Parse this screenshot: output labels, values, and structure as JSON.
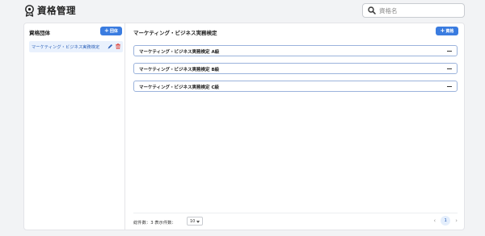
{
  "header": {
    "title": "資格管理",
    "icon": "award-badge-icon",
    "search": {
      "placeholder": "資格名",
      "value": "",
      "icon": "search-icon"
    }
  },
  "left": {
    "title": "資格団体",
    "add_button": {
      "icon": "plus-icon",
      "label": "団体"
    },
    "organizations": [
      {
        "label": "マーケティング・ビジネス実務検定",
        "selected": true,
        "edit_icon": "pencil-icon",
        "delete_icon": "trash-icon"
      }
    ]
  },
  "right": {
    "title": "マーケティング・ビジネス実務検定",
    "add_button": {
      "icon": "plus-icon",
      "label": "資格"
    },
    "certifications": [
      {
        "label": "マーケティング・ビジネス実務検定 A級",
        "action_icon": "minus-icon"
      },
      {
        "label": "マーケティング・ビジネス実務検定 B級",
        "action_icon": "minus-icon"
      },
      {
        "label": "マーケティング・ビジネス実務検定 C級",
        "action_icon": "minus-icon"
      }
    ],
    "footer": {
      "summary": "総件数：3  表示件数：",
      "page_size": "10",
      "pager": {
        "prev": "‹",
        "current": "1",
        "next": "›"
      }
    }
  },
  "colors": {
    "accent": "#3a7ce0",
    "selected_bg": "#e9f1fd",
    "delete": "#e0473f",
    "edit": "#2a5fb8"
  }
}
